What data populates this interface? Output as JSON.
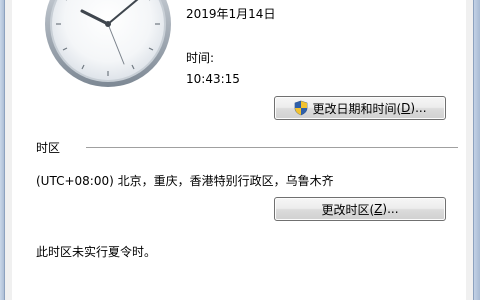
{
  "datetime": {
    "date": "2019年1月14日",
    "time_label": "时间:",
    "time_value": "10:43:15",
    "change_button": {
      "label": "更改日期和时间(",
      "accel": "D",
      "suffix": ")..."
    }
  },
  "timezone": {
    "section_title": "时区",
    "current": "(UTC+08:00) 北京，重庆，香港特别行政区，乌鲁木齐",
    "change_button": {
      "label": "更改时区(",
      "accel": "Z",
      "suffix": ")..."
    },
    "dst_note": "此时区未实行夏令时。"
  },
  "icons": {
    "clock": "analog-clock-icon",
    "shield": "uac-shield-icon"
  }
}
